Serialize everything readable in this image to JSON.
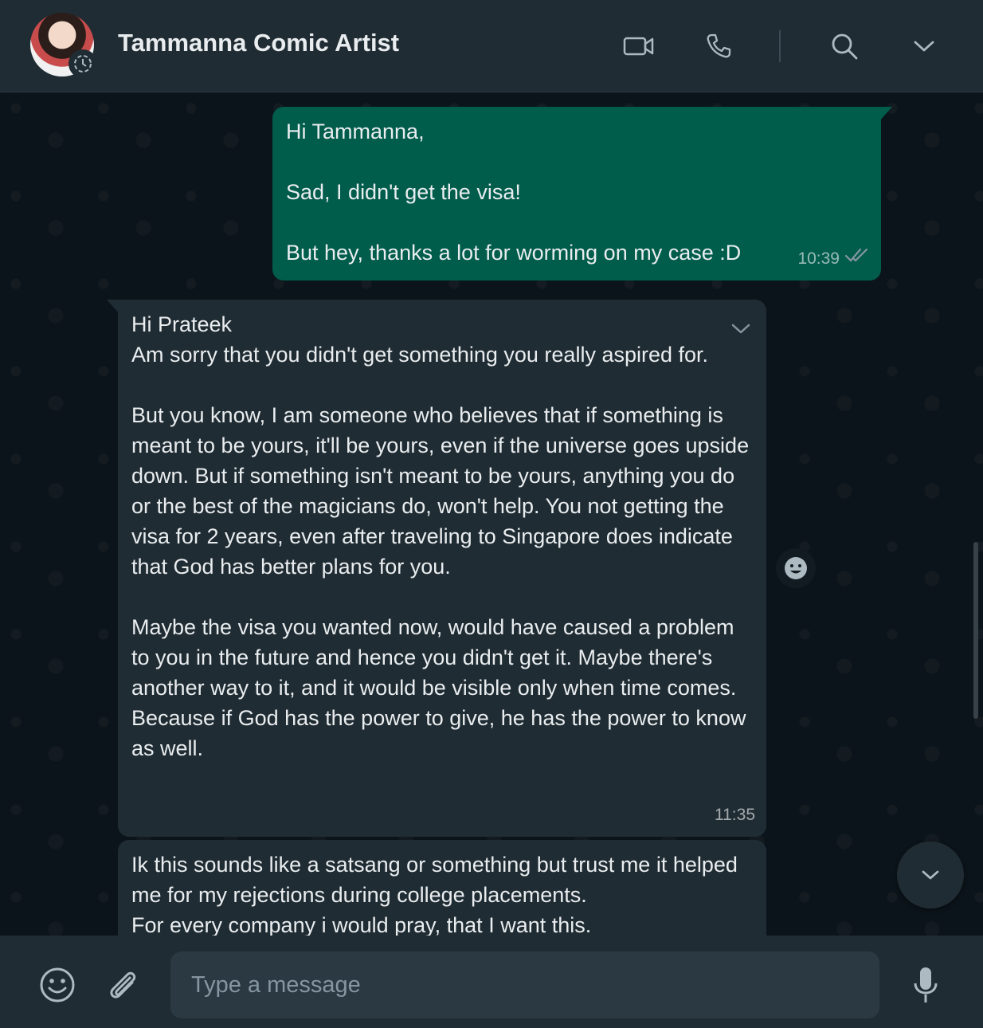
{
  "header": {
    "contact_name": "Tammanna Comic Artist",
    "icons": [
      "video-call-icon",
      "voice-call-icon",
      "search-icon",
      "chevron-down-icon"
    ]
  },
  "messages": [
    {
      "direction": "outgoing",
      "text": "Hi Tammanna,\n\nSad, I didn't get the visa!\n\nBut hey, thanks a lot for worming on my case :D",
      "time": "10:39",
      "status": "read"
    },
    {
      "direction": "incoming",
      "text": "Hi Prateek\nAm sorry that you didn't get something you really aspired for.\n\nBut you know, I am someone who believes that if something is meant to be yours, it'll be yours, even if the universe goes upside down. But if something isn't meant to be yours, anything you do or the best of the magicians do, won't help. You not getting the visa for 2 years, even after traveling to Singapore does indicate that God has better plans for you.\n\nMaybe the visa you wanted now, would have caused a problem to you in the future and hence you didn't get it. Maybe there's another way to it, and it would be visible only when time comes.\nBecause if God has the power to give, he has the power to know as well.",
      "time": "11:35"
    },
    {
      "direction": "incoming",
      "text": "Ik this sounds like a satsang or something but trust me it helped me for my rejections during college placements.\nFor every company i would pray, that I want this.",
      "time": ""
    }
  ],
  "composer": {
    "placeholder": "Type a message",
    "value": ""
  },
  "colors": {
    "header_bg": "#202c33",
    "chat_bg": "#0b141a",
    "outgoing_bubble": "#005c4b",
    "incoming_bubble": "#202c33",
    "read_tick": "#8696a0"
  }
}
